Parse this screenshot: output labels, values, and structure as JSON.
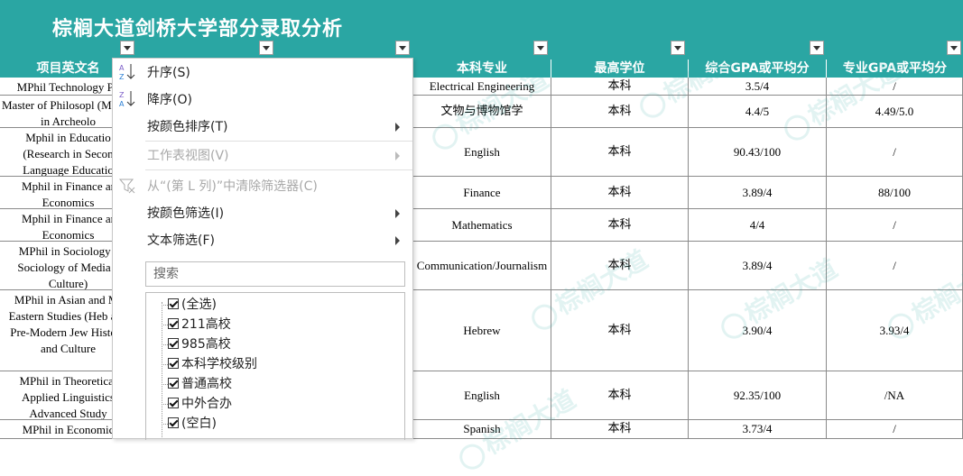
{
  "title": "棕榈大道剑桥大学部分录取分析",
  "columns": [
    "项目英文名",
    "",
    "本科专业",
    "最高学位",
    "综合GPA或平均分",
    "专业GPA或平均分"
  ],
  "rows": [
    {
      "program": "MPhil Technology Po",
      "major": "Electrical Engineering",
      "degree": "本科",
      "gpa": "3.5/4",
      "major_gpa": "/"
    },
    {
      "program": "Master of Philosopl (MPhil) in Archeolo",
      "major": "文物与博物馆学",
      "degree": "本科",
      "gpa": "4.4/5",
      "major_gpa": "4.49/5.0"
    },
    {
      "program": "Mphil in Educatio (Research in Secon Language Educatio",
      "major": "English",
      "degree": "本科",
      "gpa": "90.43/100",
      "major_gpa": "/"
    },
    {
      "program": "Mphil in Finance ar Economics",
      "major": "Finance",
      "degree": "本科",
      "gpa": "3.89/4",
      "major_gpa": "88/100"
    },
    {
      "program": "Mphil in Finance ar Economics",
      "major": "Mathematics",
      "degree": "本科",
      "gpa": "4/4",
      "major_gpa": "/"
    },
    {
      "program": "MPhil in Sociology ( Sociology of Media a Culture)",
      "major": "Communication/Journalism",
      "degree": "本科",
      "gpa": "3.89/4",
      "major_gpa": "/"
    },
    {
      "program": "MPhil in Asian and Mi Eastern Studies (Heb and Pre-Modern Jew History and Culture",
      "major": "Hebrew",
      "degree": "本科",
      "gpa": "3.90/4",
      "major_gpa": "3.93/4"
    },
    {
      "program": "MPhil in Theoretical Applied Linguistics Advanced Study",
      "major": "English",
      "degree": "本科",
      "gpa": "92.35/100",
      "major_gpa": "/NA"
    },
    {
      "program": "MPhil in Economic",
      "major": "Spanish",
      "degree": "本科",
      "gpa": "3.73/4",
      "major_gpa": "/"
    }
  ],
  "watermark": "棕榈大道",
  "menu": {
    "sort_asc": "升序(S)",
    "sort_desc": "降序(O)",
    "sort_by_color": "按颜色排序(T)",
    "sheet_view": "工作表视图(V)",
    "clear_filter": "从“(第 L 列)”中清除筛选器(C)",
    "filter_by_color": "按颜色筛选(I)",
    "text_filter": "文本筛选(F)",
    "search_placeholder": "搜索",
    "options": [
      "(全选)",
      "211高校",
      "985高校",
      "本科学校级别",
      "普通高校",
      "中外合办",
      "(空白)"
    ]
  },
  "colors": {
    "accent": "#2aa6a3"
  }
}
